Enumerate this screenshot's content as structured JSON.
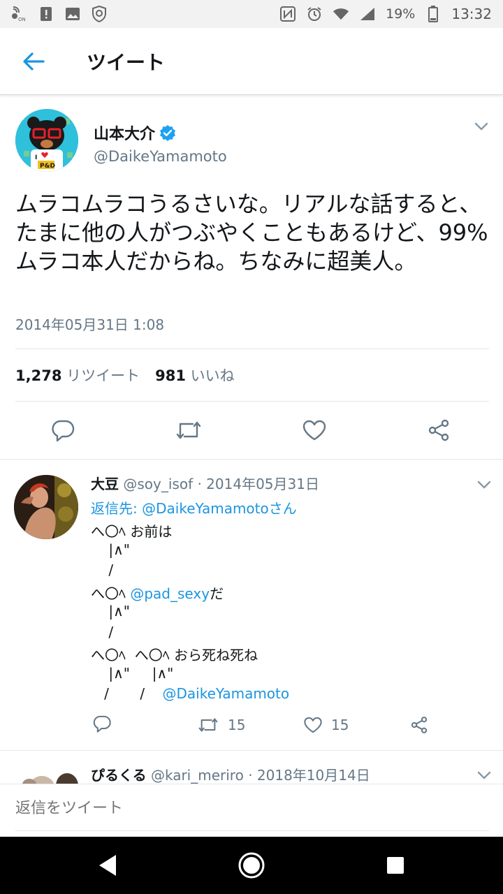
{
  "status_bar": {
    "battery": "19%",
    "time": "13:32",
    "left_icons": [
      "volte-icon",
      "alert-icon",
      "image-icon",
      "shield-icon"
    ],
    "right_icons": [
      "nfc-icon",
      "alarm-icon",
      "wifi-icon",
      "signal-icon",
      "battery-icon"
    ]
  },
  "app_bar": {
    "title": "ツイート"
  },
  "tweet": {
    "display_name": "山本大介",
    "handle": "@DaikeYamamoto",
    "verified": true,
    "text": "ムラコムラコうるさいな。リアルな話すると、たまに他の人がつぶやくこともあるけど、99%ムラコ本人だからね。ちなみに超美人。",
    "timestamp": "2014年05月31日 1:08",
    "retweets_count": "1,278",
    "retweets_label": "リツイート",
    "likes_count": "981",
    "likes_label": "いいね",
    "avatar_badge_text": "P&D"
  },
  "reply1": {
    "name": "大豆",
    "handle": "@soy_isof",
    "date": "· 2014年05月31日",
    "reply_to_prefix": "返信先: ",
    "reply_to_user": "@DaikeYamamoto",
    "reply_to_suffix": "さん",
    "line1": "へ〇ﾍ お前は",
    "line2": "    |∧\"",
    "line3": "    /",
    "line4_prefix": "へ〇ﾍ ",
    "line4_link": "@pad_sexy",
    "line4_suffix": "だ",
    "line5": "    |∧\"",
    "line6": "    /",
    "line7": "へ〇ﾍ  へ〇ﾍ おら死ね死ね",
    "line8": "    |∧\"     |∧\"",
    "line9_prefix": "   /       /    ",
    "line9_link": "@DaikeYamamoto",
    "retweets": "15",
    "likes": "15"
  },
  "reply2": {
    "name": "ぴるくる",
    "handle": "@kari_meriro",
    "date": "· 2018年10月14日"
  },
  "composer": {
    "placeholder": "返信をツイート"
  },
  "colors": {
    "accent": "#1b95e0",
    "verified": "#1da1f2",
    "secondary_text": "#657786"
  }
}
